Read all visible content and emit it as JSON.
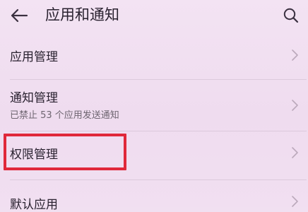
{
  "header": {
    "back_icon": "arrow-left-icon",
    "title": "应用和通知",
    "search_icon": "search-icon"
  },
  "list": {
    "items": [
      {
        "title": "应用管理",
        "subtitle": ""
      },
      {
        "title": "通知管理",
        "subtitle": "已禁止 53 个应用发送通知"
      },
      {
        "title": "权限管理",
        "subtitle": ""
      },
      {
        "title": "默认应用",
        "subtitle": ""
      }
    ]
  },
  "annotation": {
    "highlight_color": "#e0283a"
  },
  "colors": {
    "background": "#f1e0f1",
    "text": "#2a2230",
    "subtext": "#6e6570",
    "chevron": "#bba9bb"
  }
}
